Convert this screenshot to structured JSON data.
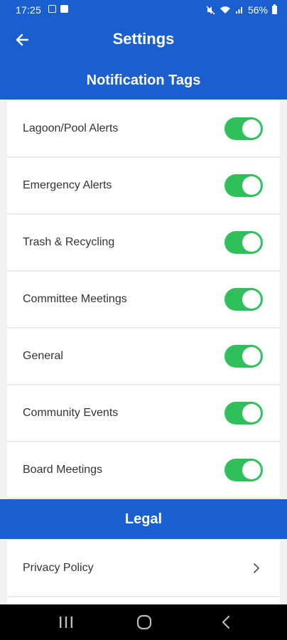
{
  "status_bar": {
    "time": "17:25",
    "battery": "56%"
  },
  "header": {
    "title": "Settings",
    "section_title": "Notification Tags"
  },
  "notification_tags": [
    {
      "label": "Lagoon/Pool Alerts",
      "enabled": true
    },
    {
      "label": "Emergency Alerts",
      "enabled": true
    },
    {
      "label": "Trash & Recycling",
      "enabled": true
    },
    {
      "label": "Committee Meetings",
      "enabled": true
    },
    {
      "label": "General",
      "enabled": true
    },
    {
      "label": "Community Events",
      "enabled": true
    },
    {
      "label": "Board Meetings",
      "enabled": true
    }
  ],
  "legal": {
    "title": "Legal",
    "items": [
      {
        "label": "Privacy Policy"
      }
    ]
  },
  "colors": {
    "primary": "#1a5fd0",
    "toggle_on": "#2fc05a",
    "background": "#f2f2f2"
  }
}
